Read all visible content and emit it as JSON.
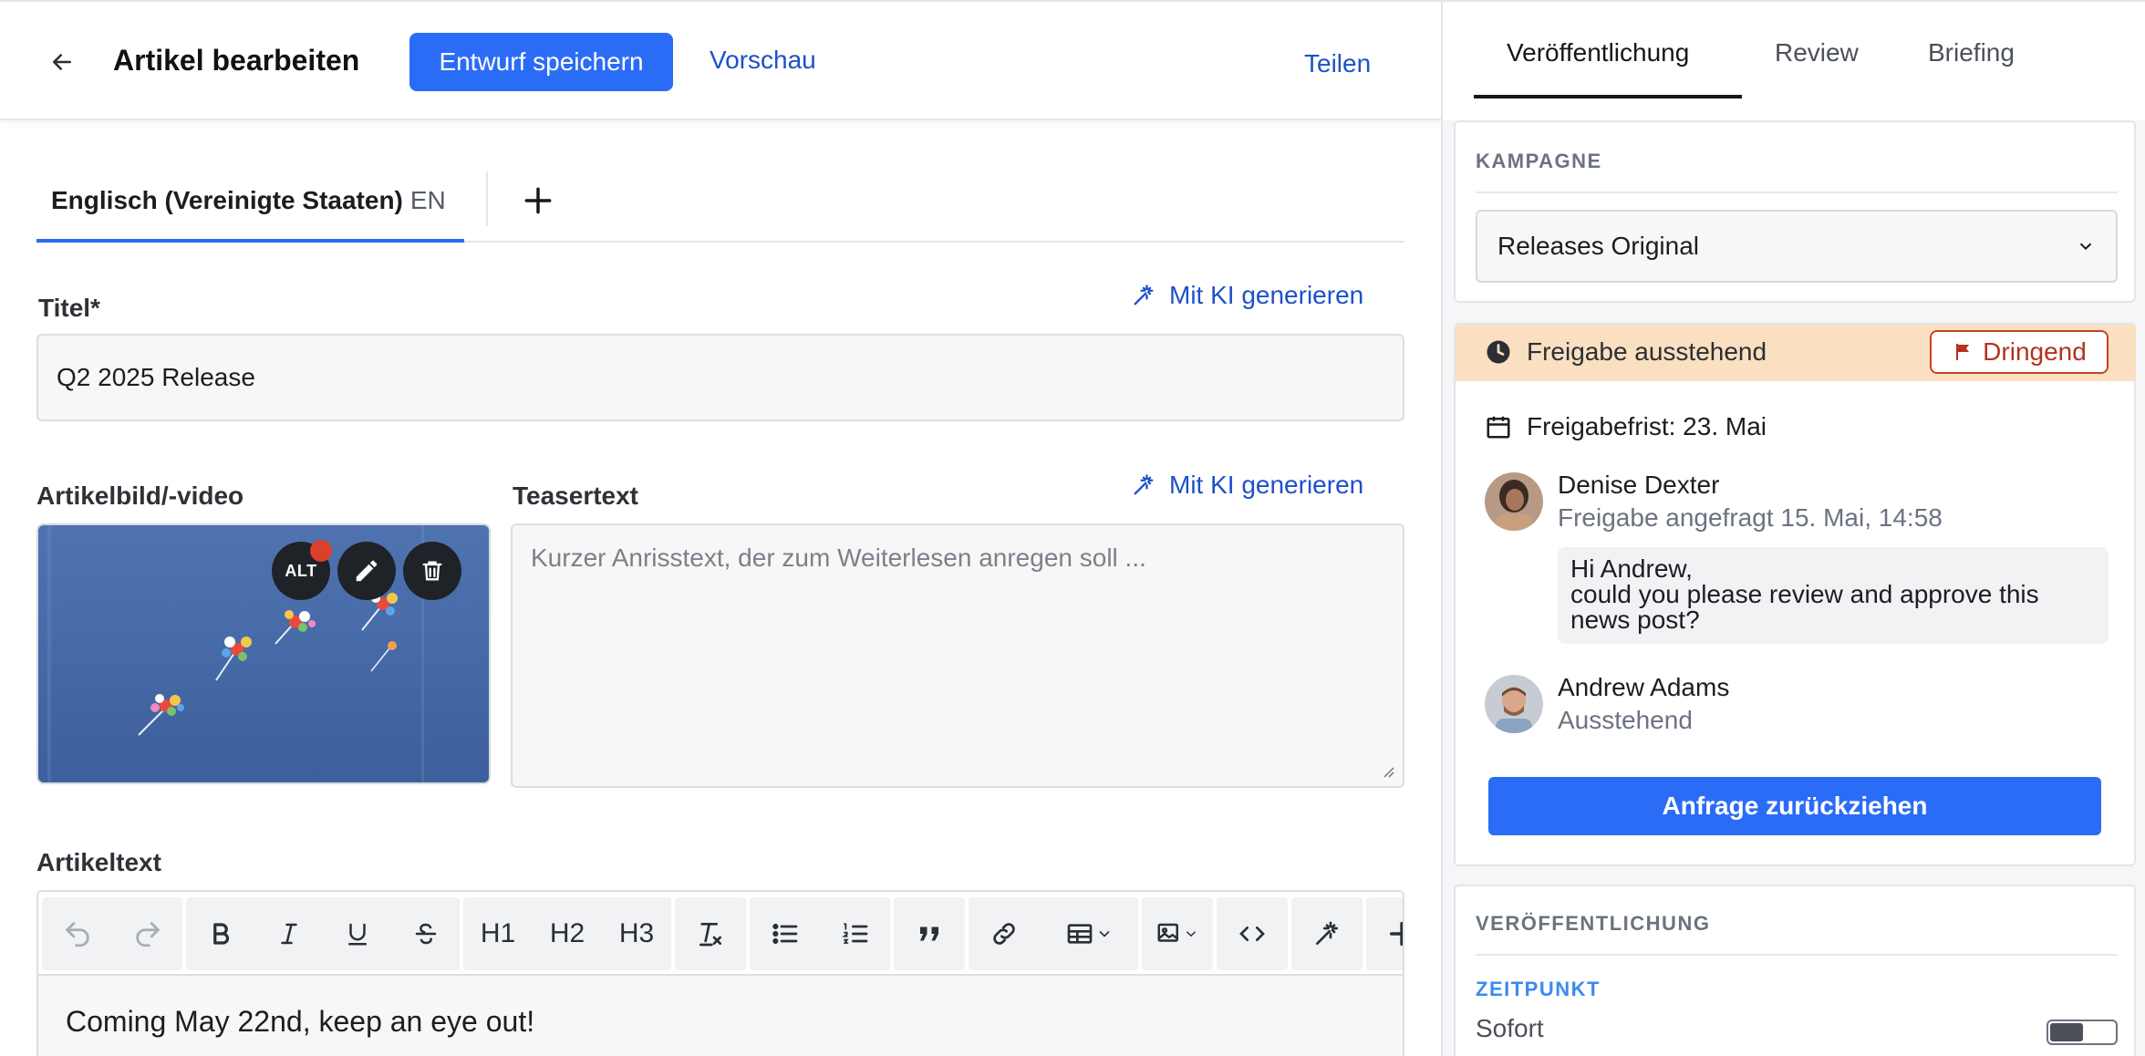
{
  "header": {
    "title": "Artikel bearbeiten",
    "save_label": "Entwurf speichern",
    "preview_label": "Vorschau",
    "share_label": "Teilen"
  },
  "language_tab": {
    "name": "Englisch (Vereinigte Staaten)",
    "code": "EN"
  },
  "title_field": {
    "label": "Titel*",
    "ai_label": "Mit KI generieren",
    "value": "Q2 2025 Release"
  },
  "media": {
    "label": "Artikelbild/-video",
    "alt_label": "ALT"
  },
  "teaser": {
    "label": "Teasertext",
    "ai_label": "Mit KI generieren",
    "placeholder": "Kurzer Anrisstext, der zum Weiterlesen anregen soll ..."
  },
  "article": {
    "label": "Artikeltext",
    "toolbar": {
      "h1": "H1",
      "h2": "H2",
      "h3": "H3"
    },
    "content": "Coming May 22nd, keep an eye out!"
  },
  "sidebar": {
    "tabs": [
      {
        "label": "Veröffentlichung"
      },
      {
        "label": "Review"
      },
      {
        "label": "Briefing"
      }
    ],
    "campaign": {
      "heading": "KAMPAGNE",
      "selected": "Releases Original"
    },
    "approval": {
      "status": "Freigabe ausstehend",
      "badge": "Dringend",
      "deadline": "Freigabefrist: 23. Mai",
      "requester_name": "Denise Dexter",
      "requester_sub": "Freigabe angefragt 15. Mai, 14:58",
      "message_line1": "Hi Andrew,",
      "message_line2": "could you please review and approve this",
      "message_line3": "news post?",
      "approver_name": "Andrew Adams",
      "approver_sub": "Ausstehend",
      "withdraw_label": "Anfrage zurückziehen"
    },
    "publication": {
      "heading": "VERÖFFENTLICHUNG",
      "subheading": "ZEITPUNKT",
      "option_label": "Sofort"
    }
  },
  "colors": {
    "primary": "#2b6cf6",
    "link": "#1d50c9",
    "warning_bg": "#fadfc0",
    "urgent": "#c8412b"
  }
}
